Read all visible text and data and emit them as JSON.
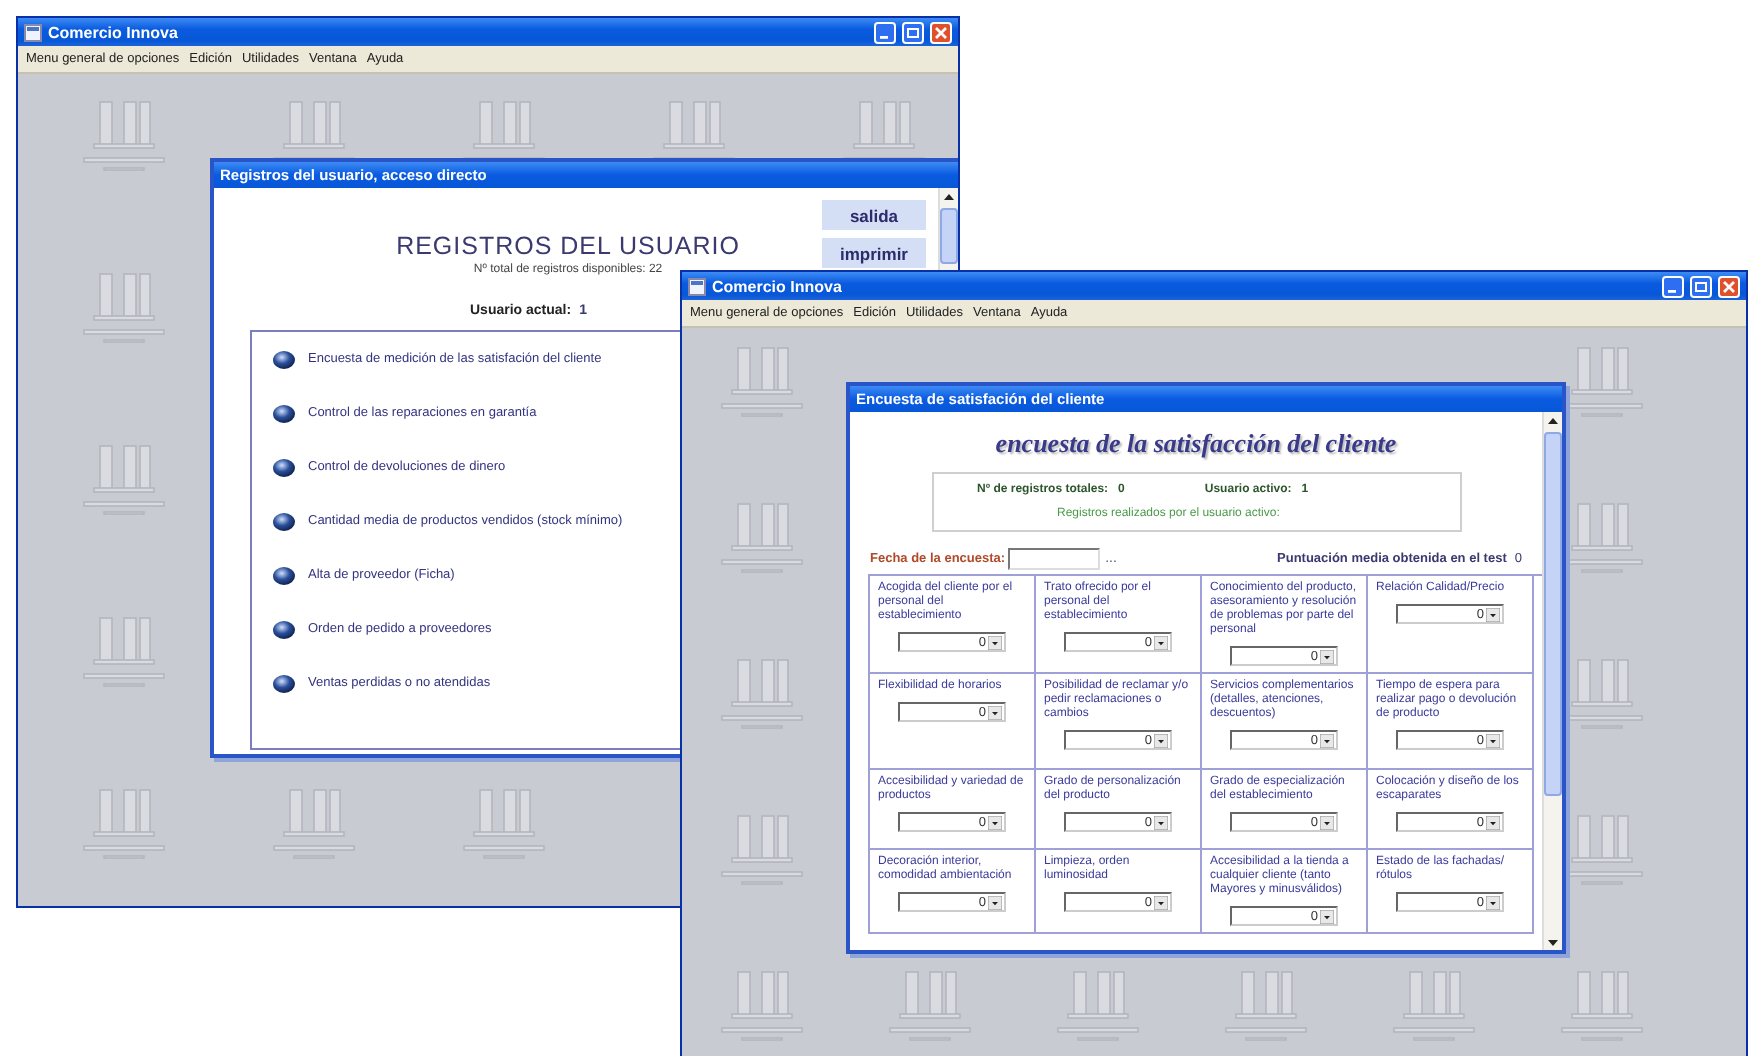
{
  "back_window": {
    "title": "Comercio Innova",
    "menu": [
      "Menu general de opciones",
      "Edición",
      "Utilidades",
      "Ventana",
      "Ayuda"
    ],
    "dialog": {
      "title": "Registros del usuario, acceso directo",
      "heading": "REGISTROS DEL USUARIO",
      "subheading": "Nº total de registros disponibles: 22",
      "buttons": [
        "salida",
        "imprimir"
      ],
      "current_user_label": "Usuario actual:",
      "current_user": "1",
      "items": [
        "Encuesta de medición de las satisfación del cliente",
        "Control de las reparaciones en garantía",
        "Control de devoluciones de dinero",
        "Cantidad media de productos vendidos (stock mínimo)",
        "Alta de proveedor (Ficha)",
        "Orden de pedido a proveedores",
        "Ventas perdidas o no atendidas"
      ]
    }
  },
  "front_window": {
    "title": "Comercio Innova",
    "menu": [
      "Menu general de opciones",
      "Edición",
      "Utilidades",
      "Ventana",
      "Ayuda"
    ],
    "dialog": {
      "title": "Encuesta de satisfación del cliente",
      "heading": "encuesta de la satisfacción del cliente",
      "summary": {
        "total_label": "Nº de registros totales:",
        "total": "0",
        "active_label": "Usuario activo:",
        "active": "1",
        "note": "Registros realizados por el usuario activo:"
      },
      "date_label": "Fecha de la encuesta:",
      "date_button": "...",
      "score_label": "Puntuación media obtenida en el test",
      "score": "0",
      "questions": [
        {
          "label": "Acogida del cliente por el personal del establecimiento",
          "value": "0"
        },
        {
          "label": "Trato ofrecido por el personal del establecimiento",
          "value": "0"
        },
        {
          "label": "Conocimiento del producto, asesoramiento y resolución de problemas por parte del personal",
          "value": "0"
        },
        {
          "label": "Relación Calidad/Precio",
          "value": "0"
        },
        {
          "label": "Flexibilidad de horarios",
          "value": "0"
        },
        {
          "label": "Posibilidad de reclamar y/o pedir reclamaciones o cambios",
          "value": "0"
        },
        {
          "label": "Servicios complementarios (detalles, atenciones, descuentos)",
          "value": "0"
        },
        {
          "label": "Tiempo de espera para realizar pago o devolución de producto",
          "value": "0"
        },
        {
          "label": "Accesibilidad y variedad de productos",
          "value": "0"
        },
        {
          "label": "Grado de personalización del producto",
          "value": "0"
        },
        {
          "label": "Grado de especialización del establecimiento",
          "value": "0"
        },
        {
          "label": "Colocación y diseño de los escaparates",
          "value": "0"
        },
        {
          "label": "Decoración interior, comodidad ambientación",
          "value": "0"
        },
        {
          "label": "Limpieza, orden luminosidad",
          "value": "0"
        },
        {
          "label": "Accesibilidad a la tienda a cualquier cliente (tanto Mayores y minusválidos)",
          "value": "0"
        },
        {
          "label": "Estado de las fachadas/ rótulos",
          "value": "0"
        }
      ]
    }
  }
}
